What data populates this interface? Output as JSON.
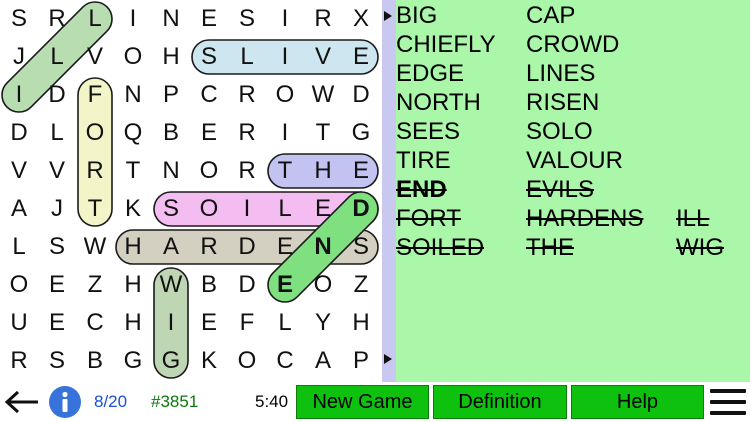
{
  "grid": {
    "rows": [
      "SRLINESIRX",
      "JLVOHSLIVE",
      "IDFNPCROWD",
      "DLOQBERITG",
      "VVRTNORTHE",
      "AJTKSOILED",
      "LSWHARDENS",
      "OEZHWBDEOZ",
      "UECHIEFLYH",
      "RSBGGKOCAP"
    ],
    "bold_cells": [
      "5-9",
      "6-8",
      "7-7"
    ],
    "highlights": [
      {
        "word": "ILL",
        "r1": 2,
        "c1": 0,
        "r2": 0,
        "c2": 2,
        "color": "#b7ddb0"
      },
      {
        "word": "FORT",
        "r1": 2,
        "c1": 2,
        "r2": 5,
        "c2": 2,
        "color": "#f3f5c9"
      },
      {
        "word": "SLIVE",
        "r1": 1,
        "c1": 5,
        "r2": 1,
        "c2": 9,
        "color": "#cde6ef"
      },
      {
        "word": "THE",
        "r1": 4,
        "c1": 7,
        "r2": 4,
        "c2": 9,
        "color": "#c3c3f2"
      },
      {
        "word": "SOILED",
        "r1": 5,
        "c1": 4,
        "r2": 5,
        "c2": 9,
        "color": "#f4bdf1"
      },
      {
        "word": "HARDENS",
        "r1": 6,
        "c1": 3,
        "r2": 6,
        "c2": 9,
        "color": "#d3cfc1"
      },
      {
        "word": "WIG",
        "r1": 7,
        "c1": 4,
        "r2": 9,
        "c2": 4,
        "color": "#bfd6b5"
      },
      {
        "word": "END",
        "r1": 7,
        "c1": 7,
        "r2": 5,
        "c2": 9,
        "color": "#7ee07e"
      }
    ]
  },
  "words": [
    {
      "text": "BIG",
      "col": 0,
      "row": 0,
      "found": false,
      "bold": false
    },
    {
      "text": "CHIEFLY",
      "col": 0,
      "row": 1,
      "found": false,
      "bold": false
    },
    {
      "text": "EDGE",
      "col": 0,
      "row": 2,
      "found": false,
      "bold": false
    },
    {
      "text": "NORTH",
      "col": 0,
      "row": 3,
      "found": false,
      "bold": false
    },
    {
      "text": "SEES",
      "col": 0,
      "row": 4,
      "found": false,
      "bold": false
    },
    {
      "text": "TIRE",
      "col": 0,
      "row": 5,
      "found": false,
      "bold": false
    },
    {
      "text": "END",
      "col": 0,
      "row": 6,
      "found": true,
      "bold": true
    },
    {
      "text": "FORT",
      "col": 0,
      "row": 7,
      "found": true,
      "bold": false
    },
    {
      "text": "SOILED",
      "col": 0,
      "row": 8,
      "found": true,
      "bold": false
    },
    {
      "text": "CAP",
      "col": 1,
      "row": 0,
      "found": false,
      "bold": false
    },
    {
      "text": "CROWD",
      "col": 1,
      "row": 1,
      "found": false,
      "bold": false
    },
    {
      "text": "LINES",
      "col": 1,
      "row": 2,
      "found": false,
      "bold": false
    },
    {
      "text": "RISEN",
      "col": 1,
      "row": 3,
      "found": false,
      "bold": false
    },
    {
      "text": "SOLO",
      "col": 1,
      "row": 4,
      "found": false,
      "bold": false
    },
    {
      "text": "VALOUR",
      "col": 1,
      "row": 5,
      "found": false,
      "bold": false
    },
    {
      "text": "EVILS",
      "col": 1,
      "row": 6,
      "found": true,
      "bold": false
    },
    {
      "text": "HARDENS",
      "col": 1,
      "row": 7,
      "found": true,
      "bold": false
    },
    {
      "text": "THE",
      "col": 1,
      "row": 8,
      "found": true,
      "bold": false
    },
    {
      "text": "ILL",
      "col": 2,
      "row": 7,
      "found": true,
      "bold": false
    },
    {
      "text": "WIG",
      "col": 2,
      "row": 8,
      "found": true,
      "bold": false
    }
  ],
  "status": {
    "back_icon": "left-arrow-icon",
    "info_icon": "info-icon",
    "progress": "8/20",
    "puzzle_number": "#3851",
    "timer": "5:40",
    "progress_color": "#1a4fd6",
    "number_color": "#0a7a0a"
  },
  "buttons": {
    "new_game": "New Game",
    "definition": "Definition",
    "help": "Help",
    "menu_icon": "hamburger-menu-icon"
  }
}
